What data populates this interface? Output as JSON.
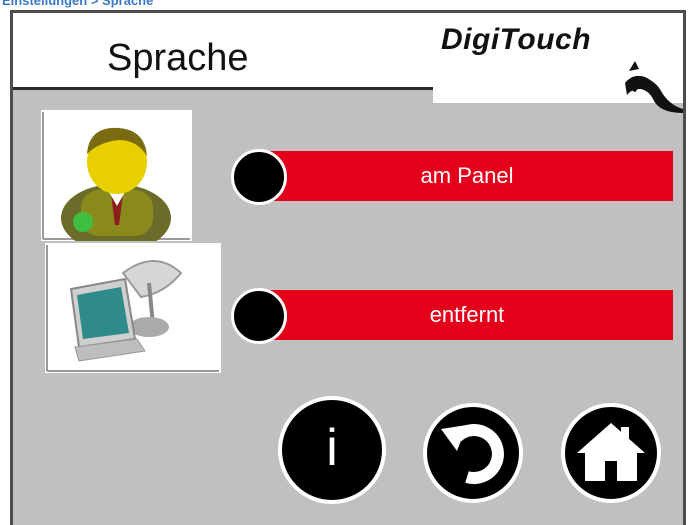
{
  "breadcrumb": "Einstellungen > Sprache",
  "title": "Sprache",
  "logo_text": "DigiTouch",
  "options": [
    {
      "label": "am Panel"
    },
    {
      "label": "entfernt"
    }
  ],
  "buttons": {
    "info_label": "i",
    "back_icon": "back-arrow-icon",
    "home_icon": "home-icon"
  },
  "colors": {
    "accent_red": "#e4001b",
    "background": "#c0c0c0",
    "breadcrumb_blue": "#3b78c8"
  }
}
